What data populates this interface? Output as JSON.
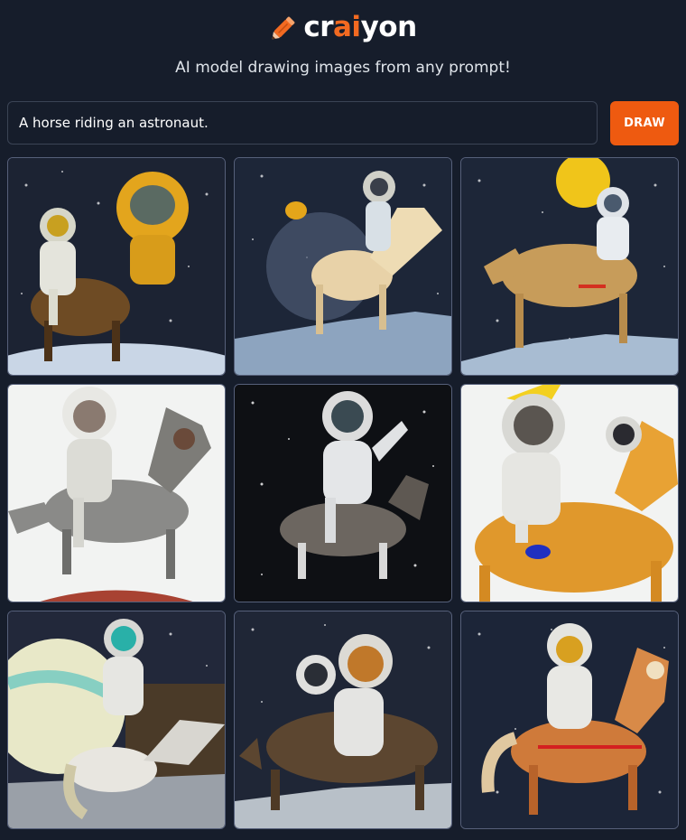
{
  "brand": {
    "name_prefix": "cr",
    "name_accent": "ai",
    "name_suffix": "yon",
    "icon": "pencil-icon",
    "accent_color": "#f26a21"
  },
  "tagline": "AI model drawing images from any prompt!",
  "prompt": {
    "value": "A horse riding an astronaut.",
    "placeholder": ""
  },
  "draw_button": {
    "label": "DRAW",
    "color": "#ee5a10"
  },
  "results": {
    "count": 9,
    "items": [
      {
        "subject": "astronaut-on-horse",
        "scene": "space-dark"
      },
      {
        "subject": "astronaut-on-horse",
        "scene": "space-dark"
      },
      {
        "subject": "astronaut-on-horse",
        "scene": "space-dark"
      },
      {
        "subject": "astronaut-on-horse",
        "scene": "white"
      },
      {
        "subject": "astronaut-on-horse",
        "scene": "space-black"
      },
      {
        "subject": "astronaut-on-horse",
        "scene": "white"
      },
      {
        "subject": "astronaut-on-horse",
        "scene": "space-dark"
      },
      {
        "subject": "astronaut-on-horse",
        "scene": "space-dark"
      },
      {
        "subject": "astronaut-on-horse",
        "scene": "space-dark"
      }
    ]
  }
}
